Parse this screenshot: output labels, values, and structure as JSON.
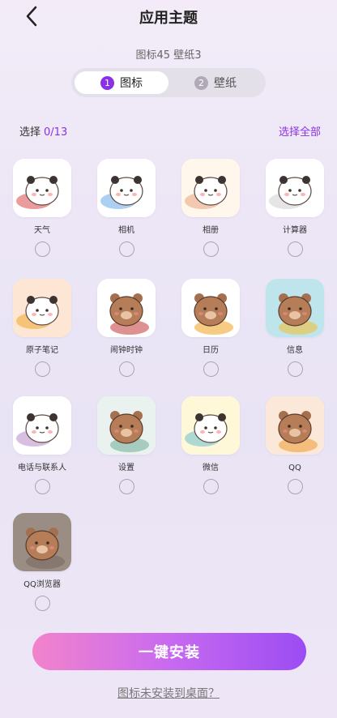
{
  "header": {
    "title": "应用主题"
  },
  "summary": {
    "text": "图标45  壁纸3"
  },
  "tabs": [
    {
      "num": "1",
      "label": "图标"
    },
    {
      "num": "2",
      "label": "壁纸"
    }
  ],
  "selection": {
    "prefix": "选择",
    "count": "0/13",
    "select_all": "选择全部"
  },
  "apps": [
    {
      "label": "天气",
      "icon": "panda-sunglasses-icon",
      "bg": "#ffffff"
    },
    {
      "label": "相机",
      "icon": "panda-camera-icon",
      "bg": "#ffffff"
    },
    {
      "label": "相册",
      "icon": "panda-album-icon",
      "bg": "#fff6ec"
    },
    {
      "label": "计算器",
      "icon": "panda-calculator-icon",
      "bg": "#ffffff"
    },
    {
      "label": "原子笔记",
      "icon": "panda-notes-icon",
      "bg": "#fde6d3"
    },
    {
      "label": "闹钟时钟",
      "icon": "bear-clock-icon",
      "bg": "#ffffff"
    },
    {
      "label": "日历",
      "icon": "bear-calendar-icon",
      "bg": "#ffffff"
    },
    {
      "label": "信息",
      "icon": "bear-message-icon",
      "bg": "#bfe5ec"
    },
    {
      "label": "电话与联系人",
      "icon": "panda-phone-icon",
      "bg": "#ffffff"
    },
    {
      "label": "设置",
      "icon": "bear-settings-icon",
      "bg": "#e9f2ee"
    },
    {
      "label": "微信",
      "icon": "panda-wechat-icon",
      "bg": "#fff8d8"
    },
    {
      "label": "QQ",
      "icon": "bear-panda-qq-icon",
      "bg": "#fce8d8"
    },
    {
      "label": "QQ浏览器",
      "icon": "bear-panda-browser-icon",
      "bg": "#9a8d84"
    }
  ],
  "install": {
    "label": "一键安装"
  },
  "help": {
    "label": "图标未安装到桌面？"
  }
}
